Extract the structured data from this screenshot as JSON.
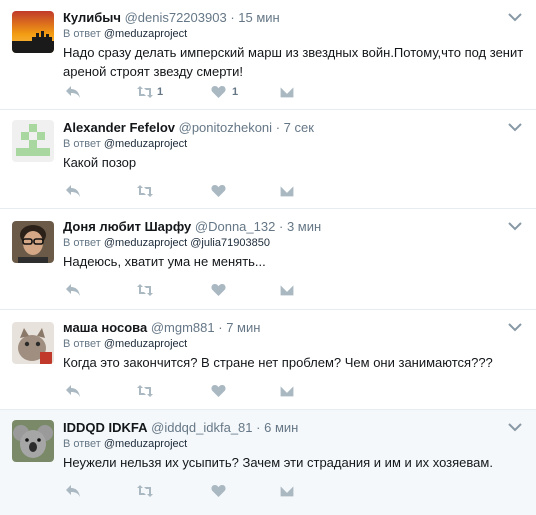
{
  "tweets": [
    {
      "name": "Кулибыч",
      "handle": "@denis72203903",
      "separator": "·",
      "time": "15 мин",
      "reply_prefix": "В ответ",
      "reply_to": "@meduzaproject",
      "text": "Надо сразу делать имперский марш из звездных войн.Потому,что под зенит ареной строят звезду смерти!",
      "retweets": "1",
      "likes": "1",
      "avatar": "sunset-silhouette"
    },
    {
      "name": "Alexander Fefelov",
      "handle": "@ponitozhekoni",
      "separator": "·",
      "time": "7 сек",
      "reply_prefix": "В ответ",
      "reply_to": "@meduzaproject",
      "text": "Какой позор",
      "retweets": "",
      "likes": "",
      "avatar": "green-identicon"
    },
    {
      "name": "Доня любит Шарфу",
      "handle": "@Donna_132",
      "separator": "·",
      "time": "3 мин",
      "reply_prefix": "В ответ",
      "reply_to": "@meduzaproject @julia71903850",
      "text": "Надеюсь, хватит ума не менять...",
      "retweets": "",
      "likes": "",
      "avatar": "man-with-glasses"
    },
    {
      "name": "маша носова",
      "handle": "@mgm881",
      "separator": "·",
      "time": "7 мин",
      "reply_prefix": "В ответ",
      "reply_to": "@meduzaproject",
      "text": "Когда это закончится? В стране нет проблем? Чем они занимаются???",
      "retweets": "",
      "likes": "",
      "avatar": "cat-photo"
    },
    {
      "name": "IDDQD IDKFA",
      "handle": "@iddqd_idkfa_81",
      "separator": "·",
      "time": "6 мин",
      "reply_prefix": "В ответ",
      "reply_to": "@meduzaproject",
      "text": "Неужели нельзя их усыпить? Зачем эти страдания и им и их хозяевам.",
      "retweets": "",
      "likes": "",
      "avatar": "koala-photo"
    }
  ],
  "icons": {
    "reply": "reply-icon",
    "retweet": "retweet-icon",
    "like": "heart-icon",
    "dm": "envelope-icon",
    "more": "chevron-down-icon"
  },
  "colors": {
    "icon": "#aab8c2",
    "muted": "#657786",
    "highlight_bg": "#f5f8fa",
    "border": "#e6ecf0"
  }
}
